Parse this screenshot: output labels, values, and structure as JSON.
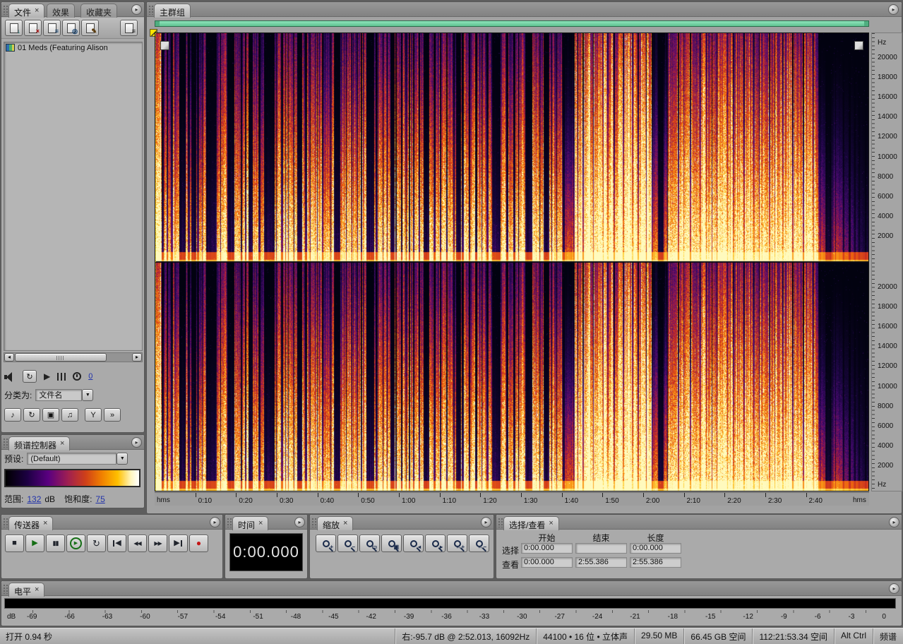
{
  "ui": {
    "close": "×",
    "dropdown": "▼",
    "panel_menu": "▸",
    "scroll_left": "◂",
    "scroll_right": "▸"
  },
  "files_panel": {
    "tabs": {
      "files": "文件",
      "effects": "效果",
      "favorites": "收藏夹"
    },
    "toolbar_icons": [
      {
        "name": "import-file",
        "glyph": "↓"
      },
      {
        "name": "close-file",
        "glyph": "×"
      },
      {
        "name": "insert-into-multitrack",
        "glyph": "≡"
      },
      {
        "name": "insert-into-cd",
        "glyph": "◎"
      },
      {
        "name": "edit-file",
        "glyph": "✎"
      },
      {
        "name": "options",
        "glyph": "≡"
      }
    ],
    "file_items": [
      {
        "name": "01 Meds (Featuring Alison"
      }
    ],
    "preview": {
      "time_value": "0"
    },
    "sort": {
      "label": "分类为:",
      "value": "文件名"
    },
    "view_toggles": [
      {
        "name": "show-audio-files",
        "glyph": "♪"
      },
      {
        "name": "show-loop-files",
        "glyph": "↻"
      },
      {
        "name": "show-video-files",
        "glyph": "▣"
      },
      {
        "name": "show-midi-files",
        "glyph": "♫"
      },
      {
        "name": "filter",
        "glyph": "Y"
      },
      {
        "name": "advanced-options",
        "glyph": "»"
      }
    ]
  },
  "spectral_controls": {
    "tab": "频谱控制器",
    "preset_label": "预设:",
    "preset_value": "(Default)",
    "range_label": "范围:",
    "range_value": "132",
    "range_unit": "dB",
    "saturation_label": "饱和度:",
    "saturation_value": "75"
  },
  "main_group": {
    "tab": "主群组",
    "freq_unit": "Hz",
    "freq_labels": [
      "20000",
      "18000",
      "16000",
      "14000",
      "12000",
      "10000",
      "8000",
      "6000",
      "4000",
      "2000"
    ],
    "time_unit": "hms",
    "time_labels": [
      "0:10",
      "0:20",
      "0:30",
      "0:40",
      "0:50",
      "1:00",
      "1:10",
      "1:20",
      "1:30",
      "1:40",
      "1:50",
      "2:00",
      "2:10",
      "2:20",
      "2:30",
      "2:40"
    ]
  },
  "transport": {
    "tab": "传送器",
    "buttons": [
      {
        "name": "stop",
        "glyph": "■"
      },
      {
        "name": "play",
        "glyph": "▶"
      },
      {
        "name": "pause",
        "glyph": "▮▮"
      },
      {
        "name": "play-from-cursor",
        "glyph": "▶"
      },
      {
        "name": "loop-play",
        "glyph": "↻"
      },
      {
        "name": "go-to-start",
        "glyph": "◀"
      },
      {
        "name": "rewind",
        "glyph": "◀◀"
      },
      {
        "name": "fast-forward",
        "glyph": "▶▶"
      },
      {
        "name": "go-to-end",
        "glyph": "▶"
      },
      {
        "name": "record",
        "glyph": "●"
      }
    ]
  },
  "time_panel": {
    "tab": "时间",
    "value": "0:00.000"
  },
  "zoom_panel": {
    "tab": "缩放",
    "buttons": [
      {
        "name": "zoom-in",
        "badge": "+"
      },
      {
        "name": "zoom-out",
        "badge": "−"
      },
      {
        "name": "zoom-out-full",
        "badge": "▭"
      },
      {
        "name": "zoom-to-selection",
        "badge": "▣"
      },
      {
        "name": "zoom-in-left-edge",
        "badge": "◂"
      },
      {
        "name": "zoom-in-right-edge",
        "badge": "▸"
      },
      {
        "name": "horizontal-zoom-in",
        "badge": "↔+"
      },
      {
        "name": "horizontal-zoom-out",
        "badge": "↔−"
      }
    ]
  },
  "selection_panel": {
    "tab": "选择/查看",
    "headers": {
      "start": "开始",
      "end": "结束",
      "length": "长度"
    },
    "rows": [
      {
        "label": "选择",
        "start": "0:00.000",
        "end": "",
        "length": "0:00.000"
      },
      {
        "label": "查看",
        "start": "0:00.000",
        "end": "2:55.386",
        "length": "2:55.386"
      }
    ]
  },
  "levels": {
    "tab": "电平",
    "unit": "dB",
    "scale": [
      "-69",
      "-66",
      "-63",
      "-60",
      "-57",
      "-54",
      "-51",
      "-48",
      "-45",
      "-42",
      "-39",
      "-36",
      "-33",
      "-30",
      "-27",
      "-24",
      "-21",
      "-18",
      "-15",
      "-12",
      "-9",
      "-6",
      "-3",
      "0"
    ]
  },
  "status_bar": {
    "left": "打开 0.94 秒",
    "segments": [
      "右:-95.7 dB @ 2:52.013, 16092Hz",
      "44100 • 16 位 • 立体声",
      "29.50 MB",
      "66.45 GB 空间",
      "112:21:53.34 空间",
      "Alt Ctrl",
      "频谱"
    ]
  },
  "colors": {
    "nav_bar_green": "#76d7a4",
    "playhead_yellow": "#ffe400",
    "record_red": "#c41616"
  }
}
